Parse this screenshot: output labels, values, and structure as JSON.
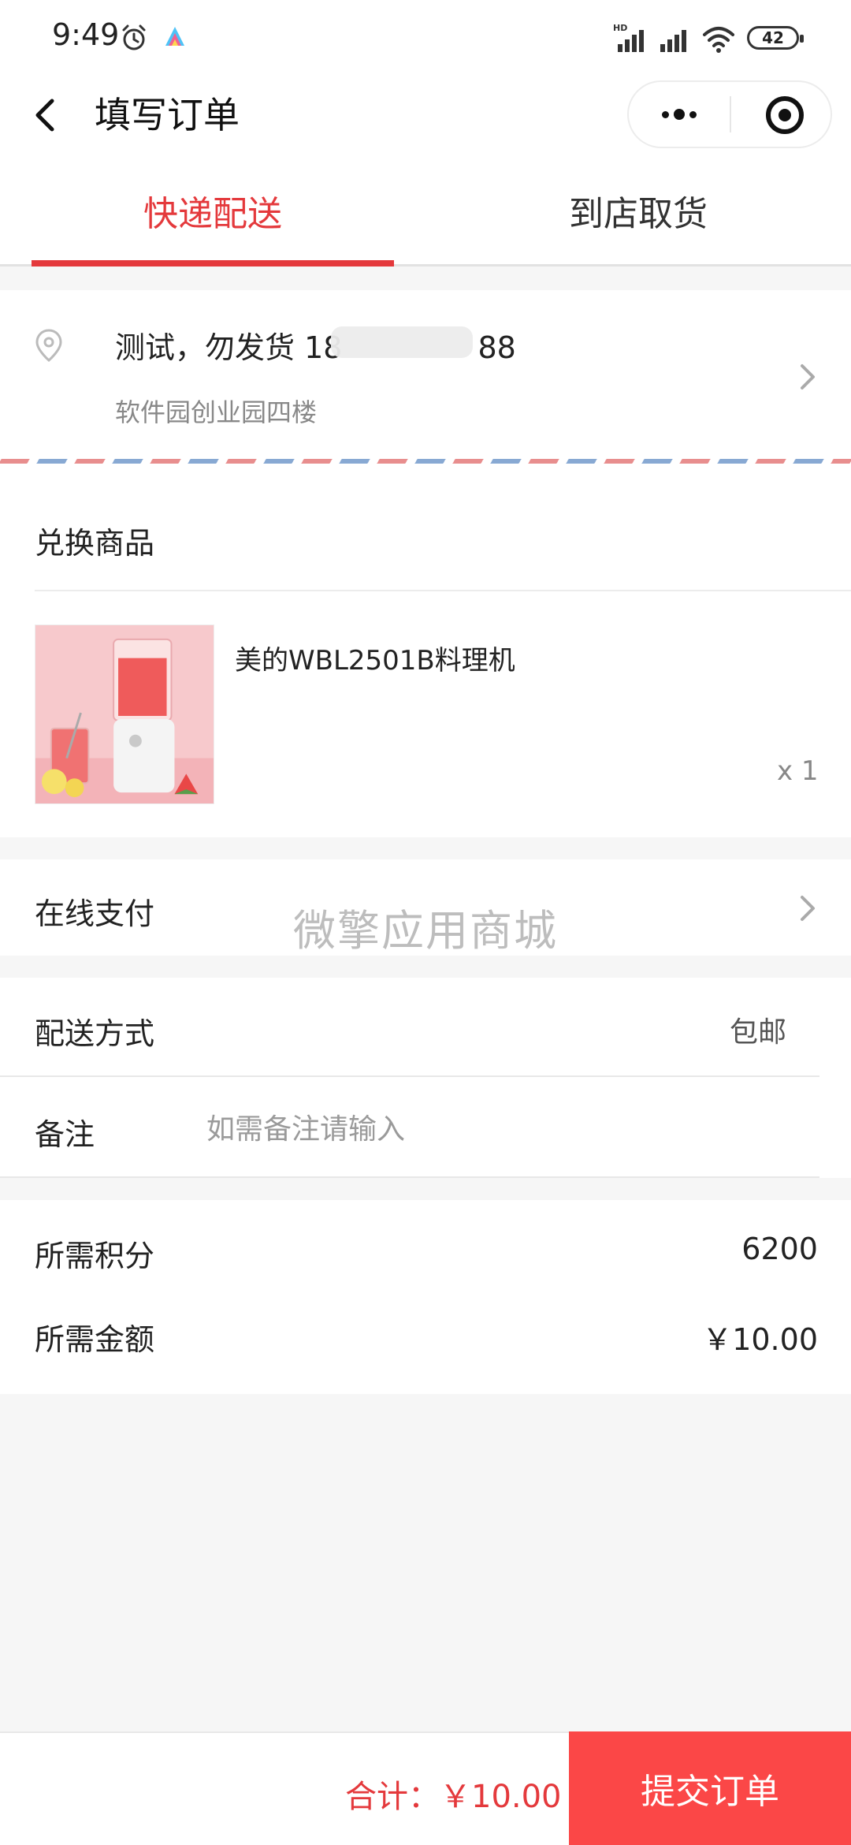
{
  "status_bar": {
    "time": "9:49",
    "battery": "42"
  },
  "nav": {
    "title": "填写订单"
  },
  "tabs": [
    {
      "label": "快递配送",
      "active": true
    },
    {
      "label": "到店取货",
      "active": false
    }
  ],
  "address": {
    "name_line": "测试，勿发货 18",
    "phone_tail": "88",
    "detail": "软件园创业园四楼"
  },
  "goods": {
    "section_title": "兑换商品",
    "items": [
      {
        "name": "美的WBL2501B料理机",
        "quantity": "x 1"
      }
    ]
  },
  "payment": {
    "label": "在线支付",
    "watermark": "微擎应用商城"
  },
  "delivery": {
    "label": "配送方式",
    "value": "包邮"
  },
  "remark": {
    "label": "备注",
    "placeholder": "如需备注请输入"
  },
  "summary": {
    "points_label": "所需积分",
    "points_value": "6200",
    "amount_label": "所需金额",
    "amount_value": "￥10.00"
  },
  "footer": {
    "total": "合计：￥10.00",
    "submit_label": "提交订单"
  },
  "colors": {
    "accent": "#e4393c",
    "submit_bg": "#fb4747"
  }
}
